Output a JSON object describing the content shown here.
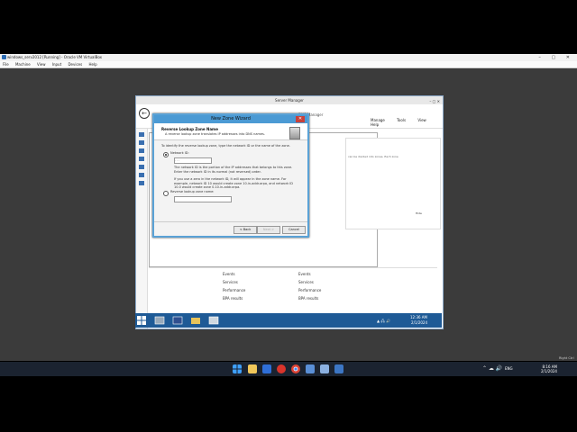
{
  "host": {
    "window_title": "windows_serv2012 [Running] - Oracle VM VirtualBox",
    "menu": [
      "File",
      "Machine",
      "View",
      "Input",
      "Devices",
      "Help"
    ],
    "window_controls": "–  ▢  ✕",
    "right_ctrl_label": "Right Ctrl",
    "taskbar": {
      "lang": "ENG",
      "time": "8:16 AM",
      "date": "2/1/2024",
      "tray": "⌃ ☁ 🔊",
      "icons": [
        "windows-start",
        "search",
        "file-explorer",
        "store",
        "media",
        "chrome",
        "mail",
        "virtualbox",
        "app"
      ]
    }
  },
  "server_manager": {
    "title": "Server Manager",
    "dns_title": "DNS Manager",
    "window_controls": "–  ▢  ✕",
    "menu": [
      "Manage",
      "Tools",
      "View",
      "Help"
    ],
    "hint_text": "can be divided into zones. Each zone",
    "hide_label": "Hide",
    "left_links": [
      "Events",
      "Services",
      "Performance",
      "BPA results"
    ],
    "right_links": [
      "Events",
      "Services",
      "Performance",
      "BPA results"
    ]
  },
  "wizard": {
    "title": "New Zone Wizard",
    "close": "✕",
    "heading": "Reverse Lookup Zone Name",
    "description": "A reverse lookup zone translates IP addresses into DNS names.",
    "intro": "To identify the reverse lookup zone, type the network ID or the name of the zone.",
    "radio_network_id": "Network ID:",
    "network_id_value": ". . .",
    "network_id_help": "The network ID is the portion of the IP addresses that belongs to this zone. Enter the network ID in its normal (not reversed) order.",
    "zero_help": "If you use a zero in the network ID, it will appear in the zone name. For example, network ID 10 would create zone 10.in-addr.arpa, and network ID 10.0 would create zone 0.10.in-addr.arpa.",
    "radio_zone_name": "Reverse lookup zone name:",
    "zone_name_value": "",
    "buttons": {
      "back": "< Back",
      "next": "Next >",
      "cancel": "Cancel"
    }
  },
  "guest_taskbar": {
    "time": "12:36 AM",
    "date": "2/1/2024",
    "tray": "▲ 🖧 🔊"
  }
}
